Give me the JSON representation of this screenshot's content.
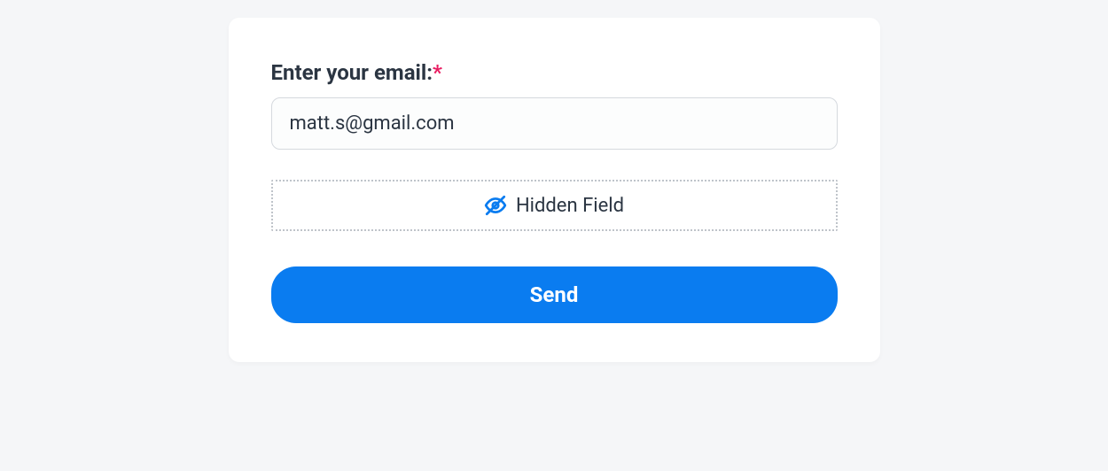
{
  "form": {
    "email_label": "Enter your email:",
    "required_marker": "*",
    "email_value": "matt.s@gmail.com",
    "hidden_field_label": "Hidden Field",
    "submit_label": "Send"
  },
  "colors": {
    "accent": "#0a7cf0",
    "required": "#e91e63"
  }
}
